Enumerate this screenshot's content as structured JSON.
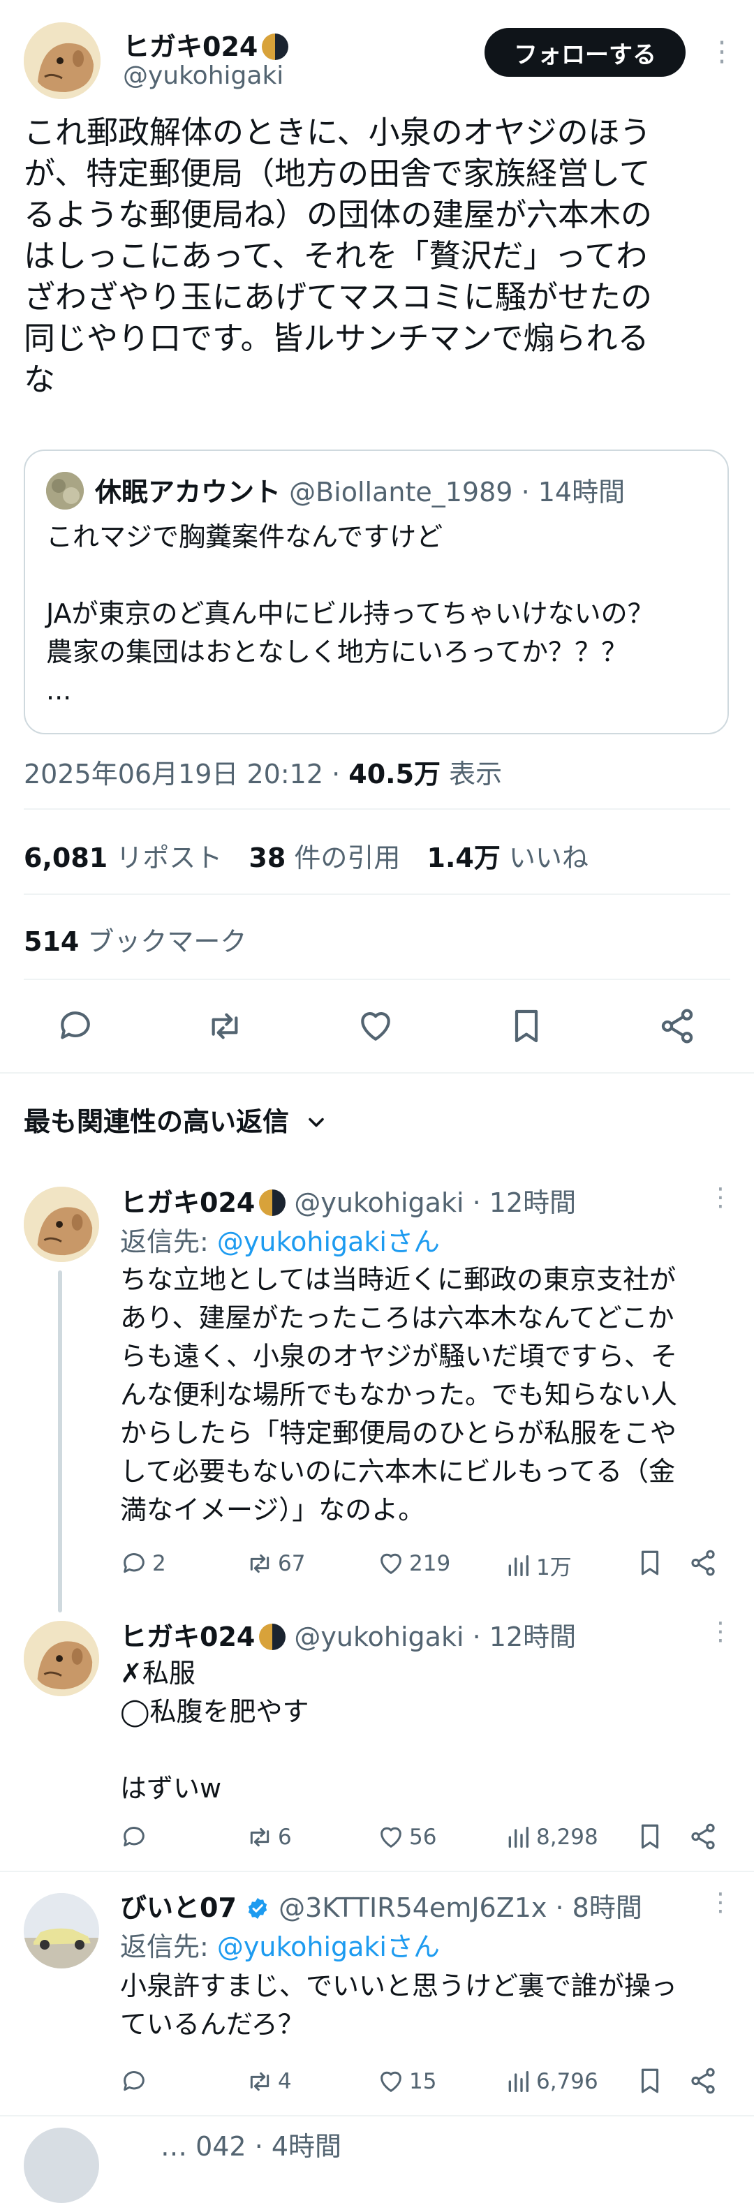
{
  "tweet": {
    "author_name": "ヒガキ024",
    "author_handle": "@yukohigaki",
    "follow_label": "フォローする",
    "text": [
      "これ郵政解体のときに、小泉のオヤジのほう",
      "が、特定郵便局（地方の田舎で家族経営して",
      "るような郵便局ね）の団体の建屋が六本木の",
      "はしっこにあって、それを「贅沢だ」ってわ",
      "ざわざやり玉にあげてマスコミに騒がせたの",
      "同じやり口です。皆ルサンチマンで煽られる",
      "な"
    ],
    "timestamp": "2025年06月19日 20:12",
    "views_count": "40.5万",
    "views_label": "表示",
    "sep": "·"
  },
  "quote": {
    "name": "休眠アカウント",
    "handle": "@Biollante_1989",
    "time": "· 14時間",
    "lines": [
      "これマジで胸糞案件なんですけど",
      "",
      "JAが東京のど真ん中にビル持ってちゃいけないの？",
      "農家の集団はおとなしく地方にいろってか？？？",
      "..."
    ]
  },
  "stats": {
    "reposts_count": "6,081",
    "reposts_label": "リポスト",
    "quotes_count": "38",
    "quotes_label": "件の引用",
    "likes_count": "1.4万",
    "likes_label": "いいね",
    "bookmarks_count": "514",
    "bookmarks_label": "ブックマーク"
  },
  "sort": {
    "label": "最も関連性の高い返信"
  },
  "replies": [
    {
      "name": "ヒガキ024",
      "handle": "@yukohigaki",
      "time": "· 12時間",
      "reply_to_prefix": "返信先: ",
      "reply_to_handle": "@yukohigakiさん",
      "lines": [
        "ちな立地としては当時近くに郵政の東京支社が",
        "あり、建屋がたったころは六本木なんてどこか",
        "らも遠く、小泉のオヤジが騒いだ頃ですら、そ",
        "んな便利な場所でもなかった。でも知らない人",
        "からしたら「特定郵便局のひとらが私服をこや",
        "して必要もないのに六本木にビルもってる（金",
        "満なイメージ）」なのよ。"
      ],
      "metrics": {
        "replies": "2",
        "reposts": "67",
        "likes": "219",
        "views": "1万"
      }
    },
    {
      "name": "ヒガキ024",
      "handle": "@yukohigaki",
      "time": "· 12時間",
      "lines": [
        "✗私服",
        "◯私腹を肥やす",
        "",
        "はずいw"
      ],
      "metrics": {
        "replies": "",
        "reposts": "6",
        "likes": "56",
        "views": "8,298"
      }
    },
    {
      "name": "びいと07",
      "handle": "@3KTTIR54emJ6Z1x",
      "time": "· 8時間",
      "reply_to_prefix": "返信先: ",
      "reply_to_handle": "@yukohigakiさん",
      "lines": [
        "小泉許すまじ、でいいと思うけど裏で誰が操っ",
        "ているんだろ？"
      ],
      "metrics": {
        "replies": "",
        "reposts": "4",
        "likes": "15",
        "views": "6,796"
      }
    }
  ],
  "peek": {
    "text": "… 042 · 4時間"
  },
  "colors": {
    "accent": "#1d9bf0",
    "text": "#0f1419",
    "muted": "#536471"
  }
}
